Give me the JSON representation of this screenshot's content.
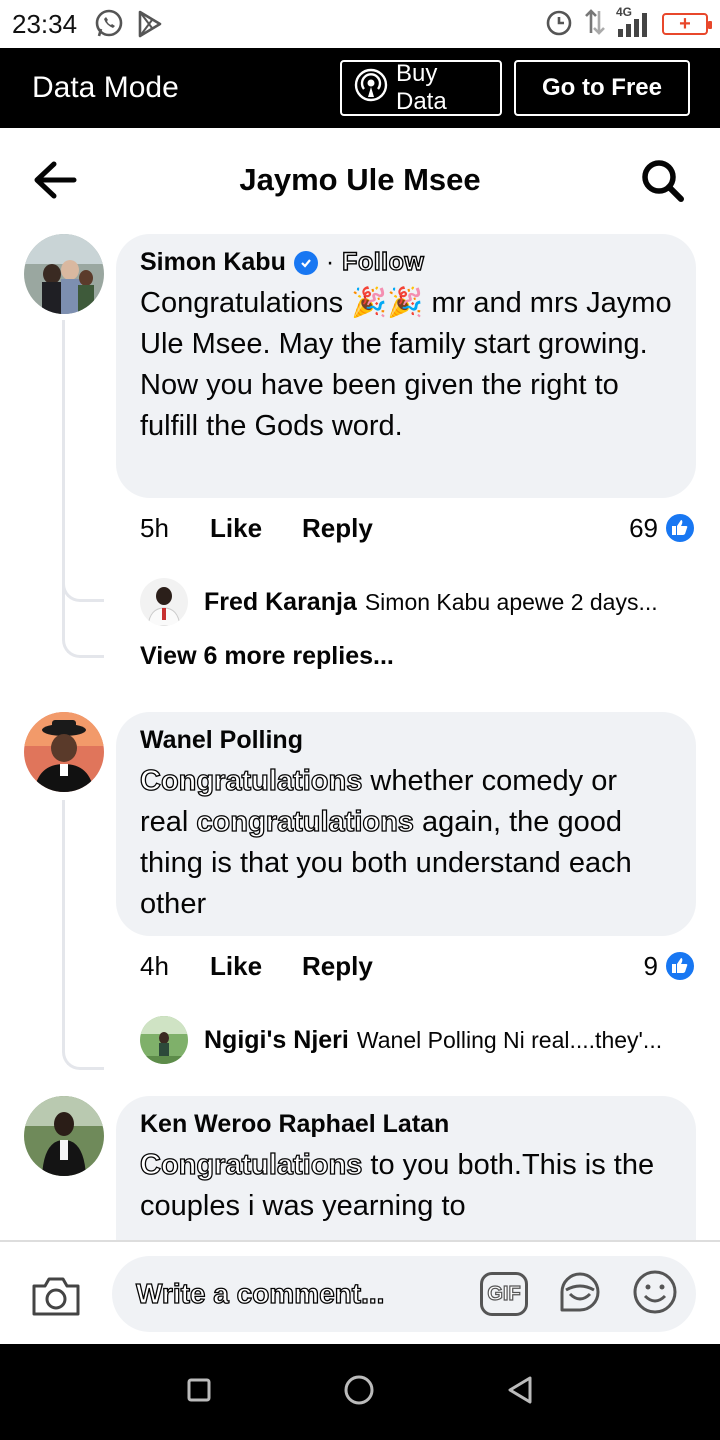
{
  "status_bar": {
    "time": "23:34",
    "network": "4G",
    "battery_symbol": "+"
  },
  "data_mode": {
    "title": "Data Mode",
    "buy_data_label": "Buy Data",
    "go_free_label": "Go to Free"
  },
  "header": {
    "title": "Jaymo Ule Msee"
  },
  "comments": [
    {
      "author": "Simon Kabu",
      "verified": true,
      "follow_label": "Follow",
      "follow_sep": "·",
      "text_part1": "Congratulations",
      "emoji": "🎉🎉",
      "text_part2": "mr and mrs Jaymo Ule Msee. May the family start growing. Now you have been given the right to fulfill the Gods word.",
      "age": "5h",
      "like_label": "Like",
      "reply_label": "Reply",
      "reaction_count": "69",
      "reply": {
        "author": "Fred Karanja",
        "text": "Simon Kabu apewe 2 days..."
      },
      "more_replies": "View 6 more replies..."
    },
    {
      "author": "Wanel Polling",
      "highlight1": "Congratulations",
      "mid1": "whether comedy or real",
      "highlight2": "congratulations",
      "mid2": "again, the good thing is that you both understand each other",
      "age": "4h",
      "like_label": "Like",
      "reply_label": "Reply",
      "reaction_count": "9",
      "reply": {
        "author": "Ngigi's Njeri",
        "text": "Wanel Polling Ni real....they'..."
      }
    },
    {
      "author": "Ken Weroo Raphael Latan",
      "highlight1": "Congratulations",
      "text": "to you both.This is the couples i was yearning to"
    }
  ],
  "composer": {
    "placeholder": "Write a comment...",
    "gif_label": "GIF"
  },
  "colors": {
    "accent": "#1877f2",
    "bubble": "#f0f2f5",
    "battery": "#e8472b"
  }
}
